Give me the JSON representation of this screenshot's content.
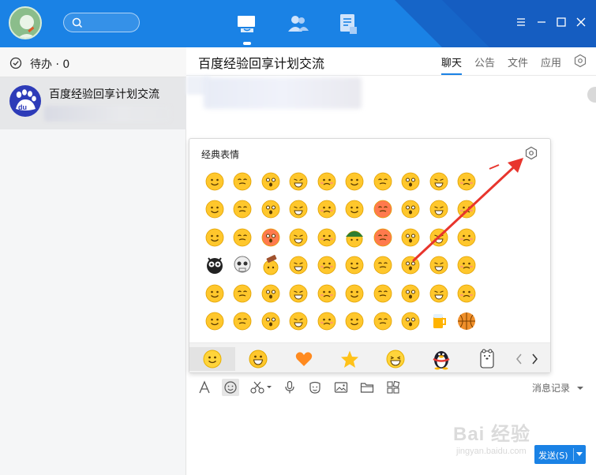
{
  "colors": {
    "titlebar": "#1a82e5",
    "accent": "#1a82e5",
    "annotation_arrow": "#e8352d"
  },
  "titlebar": {
    "nav": [
      "chat-icon",
      "contacts-icon",
      "docs-icon"
    ],
    "window_controls": [
      "menu-icon",
      "minimize-icon",
      "maximize-icon",
      "close-icon"
    ]
  },
  "sidebar": {
    "todo_label": "待办 · 0",
    "conversations": [
      {
        "name": "百度经验回享计划交流",
        "icon": "baidu-du-icon"
      }
    ]
  },
  "chat": {
    "title": "百度经验回享计划交流",
    "tabs": [
      "聊天",
      "公告",
      "文件",
      "应用"
    ],
    "active_tab": "聊天"
  },
  "emoji_panel": {
    "title": "经典表情",
    "grid_icons": "classic-emoji-icons (60 items, 10 x 6)",
    "categories": [
      "classic-smile",
      "grin",
      "heart",
      "star",
      "laugh",
      "penguin",
      "bear"
    ]
  },
  "toolbar": {
    "tools": [
      "font-icon",
      "emoji-icon",
      "screenshot-icon",
      "voice-icon",
      "sticker-icon",
      "image-icon",
      "folder-icon",
      "app-icon"
    ],
    "history_label": "消息记录",
    "send_label": "发送(S)"
  },
  "watermark": {
    "main": "Bai 经验",
    "sub": "jingyan.baidu.com"
  }
}
